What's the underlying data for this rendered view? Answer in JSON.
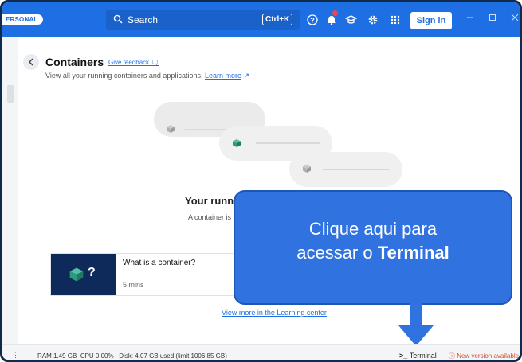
{
  "titlebar": {
    "account_badge": "ERSONAL",
    "search_placeholder": "Search",
    "shortcut": "Ctrl+K",
    "signin_label": "Sign in",
    "icons": [
      "help-icon",
      "notification-bell-icon",
      "learning-icon",
      "settings-gear-icon",
      "apps-grid-icon"
    ],
    "window_controls": [
      "minimize",
      "maximize",
      "close"
    ],
    "accent_color": "#1f6fe4"
  },
  "page": {
    "title": "Containers",
    "feedback_link": "Give feedback",
    "subtitle": "View all your running containers and applications.",
    "learn_more": "Learn more"
  },
  "empty_state": {
    "title": "Your runnin",
    "subtitle": "A container is"
  },
  "learning_card": {
    "question_mark": "?",
    "title": "What is a container?",
    "duration": "5 mins"
  },
  "view_more_link": "View more in the Learning center",
  "callout": {
    "line1": "Clique aqui para",
    "line2_prefix": "acessar o ",
    "line2_bold": "Terminal",
    "color": "#2f72e0"
  },
  "statusbar": {
    "ram": "RAM 1.49 GB",
    "cpu": "CPU 0.00%",
    "disk": "Disk: 4.07 GB used (limit 1006.85 GB)",
    "terminal": "Terminal",
    "terminal_prompt": ">_",
    "update": "New version available"
  }
}
